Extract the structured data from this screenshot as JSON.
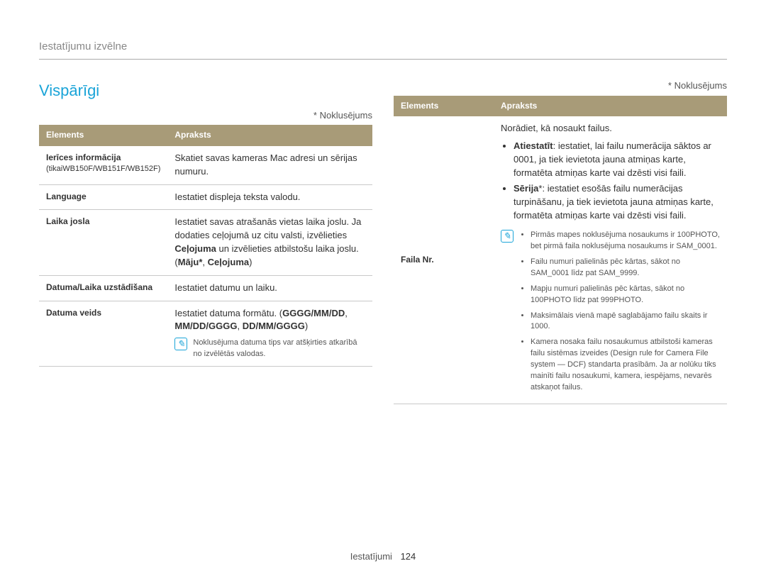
{
  "breadcrumb": "Iestatījumu izvēlne",
  "section_title": "Vispārīgi",
  "default_note": "* Noklusējums",
  "headers": {
    "elements": "Elements",
    "desc": "Apraksts"
  },
  "left_rows": [
    {
      "key_main": "Ierīces informācija",
      "key_sub": "(tikaiWB150F/WB151F/WB152F)",
      "desc_html": "Skatiet savas kameras Mac adresi un sērijas numuru."
    },
    {
      "key_main": "Language",
      "key_sub": "",
      "desc_html": "Iestatiet displeja teksta valodu."
    },
    {
      "key_main": "Laika josla",
      "key_sub": "",
      "desc_html": "Iestatiet savas atrašanās vietas laika joslu. Ja dodaties ceļojumā uz citu valsti, izvēlieties <b>Ceļojuma</b> un izvēlieties atbilstošu laika joslu. (<b>Māju*</b>, <b>Ceļojuma</b>)"
    },
    {
      "key_main": "Datuma/Laika uzstādīšana",
      "key_sub": "",
      "desc_html": "Iestatiet datumu un laiku."
    },
    {
      "key_main": "Datuma veids",
      "key_sub": "",
      "desc_html": "Iestatiet datuma formātu. (<b>GGGG/MM/DD</b>, <b>MM/DD/GGGG</b>, <b>DD/MM/GGGG</b>)",
      "note": "Noklusējuma datuma tips var atšķirties atkarībā no izvēlētās valodas."
    }
  ],
  "right_row": {
    "key_main": "Faila Nr.",
    "intro": "Norādiet, kā nosaukt failus.",
    "bullets": [
      "<b>Atiestatīt</b>: iestatiet, lai failu numerācija sāktos ar 0001, ja tiek ievietota jauna atmiņas karte, formatēta atmiņas karte vai dzēsti visi faili.",
      "<b>Sērija</b>*: iestatiet esošās failu numerācijas turpināšanu, ja tiek ievietota jauna atmiņas karte, formatēta atmiņas karte vai dzēsti visi faili."
    ],
    "notes": [
      "Pirmās mapes noklusējuma nosaukums ir 100PHOTO, bet pirmā faila noklusējuma nosaukums ir SAM_0001.",
      "Failu numuri palielinās pēc kārtas, sākot no SAM_0001 līdz pat SAM_9999.",
      "Mapju numuri palielinās pēc kārtas, sākot no 100PHOTO līdz pat 999PHOTO.",
      "Maksimālais vienā mapē saglabājamo failu skaits ir 1000.",
      "Kamera nosaka failu nosaukumus atbilstoši kameras failu sistēmas izveides (Design rule for Camera File system — DCF) standarta prasībām. Ja ar nolūku tiks mainīti failu nosaukumi, kamera, iespējams, nevarēs atskaņot failus."
    ]
  },
  "footer": {
    "label": "Iestatījumi",
    "page": "124"
  }
}
